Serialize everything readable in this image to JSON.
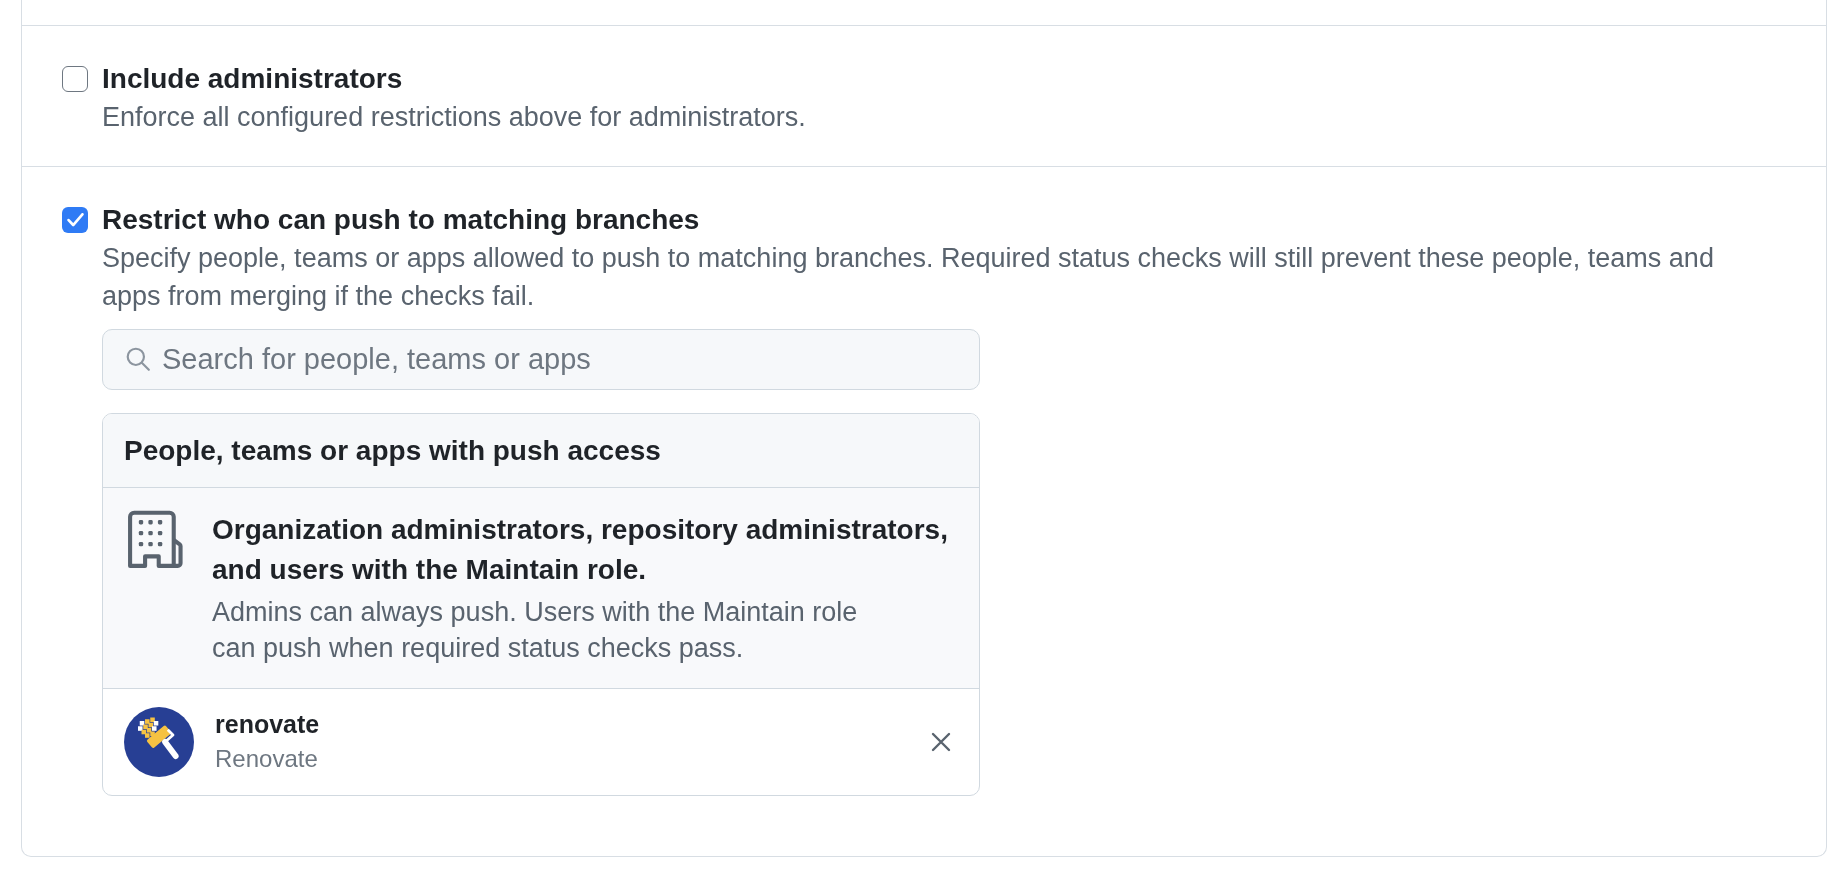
{
  "settings": [
    {
      "label": "Include administrators",
      "description": "Enforce all configured restrictions above for administrators.",
      "checked": false
    },
    {
      "label": "Restrict who can push to matching branches",
      "description": "Specify people, teams or apps allowed to push to matching branches. Required status checks will still prevent these people, teams and apps from merging if the checks fail.",
      "checked": true,
      "search": {
        "placeholder": "Search for people, teams or apps"
      },
      "access_list": {
        "title": "People, teams or apps with push access",
        "default_entry": {
          "title": "Organization administrators, repository administrators, and users with the Maintain role.",
          "description": "Admins can always push. Users with the Maintain role can push when required status checks pass."
        },
        "members": [
          {
            "username": "renovate",
            "name": "Renovate"
          }
        ]
      }
    }
  ]
}
